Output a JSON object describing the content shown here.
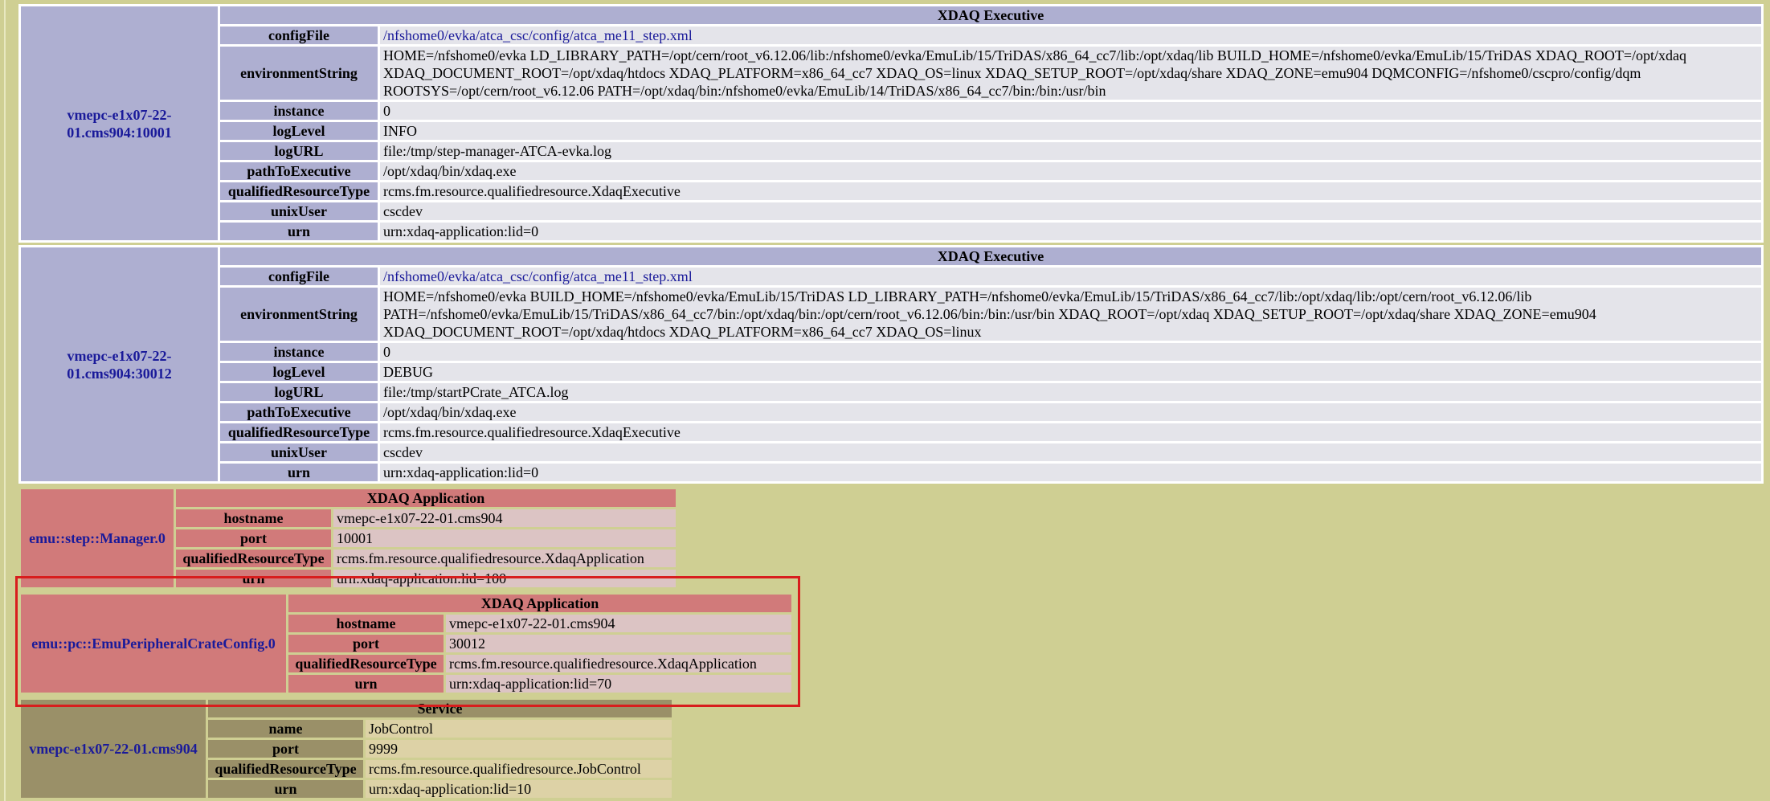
{
  "executives": [
    {
      "host": "vmepc-e1x07-22-01.cms904:10001",
      "header": "XDAQ Executive",
      "rows": [
        {
          "key": "configFile",
          "value": "/nfshome0/evka/atca_csc/config/atca_me11_step.xml"
        },
        {
          "key": "environmentString",
          "value": "HOME=/nfshome0/evka LD_LIBRARY_PATH=/opt/cern/root_v6.12.06/lib:/nfshome0/evka/EmuLib/15/TriDAS/x86_64_cc7/lib:/opt/xdaq/lib BUILD_HOME=/nfshome0/evka/EmuLib/15/TriDAS XDAQ_ROOT=/opt/xdaq XDAQ_DOCUMENT_ROOT=/opt/xdaq/htdocs XDAQ_PLATFORM=x86_64_cc7 XDAQ_OS=linux XDAQ_SETUP_ROOT=/opt/xdaq/share XDAQ_ZONE=emu904 DQMCONFIG=/nfshome0/cscpro/config/dqm ROOTSYS=/opt/cern/root_v6.12.06 PATH=/opt/xdaq/bin:/nfshome0/evka/EmuLib/14/TriDAS/x86_64_cc7/bin:/bin:/usr/bin"
        },
        {
          "key": "instance",
          "value": "0"
        },
        {
          "key": "logLevel",
          "value": "INFO"
        },
        {
          "key": "logURL",
          "value": "file:/tmp/step-manager-ATCA-evka.log"
        },
        {
          "key": "pathToExecutive",
          "value": "/opt/xdaq/bin/xdaq.exe"
        },
        {
          "key": "qualifiedResourceType",
          "value": "rcms.fm.resource.qualifiedresource.XdaqExecutive"
        },
        {
          "key": "unixUser",
          "value": "cscdev"
        },
        {
          "key": "urn",
          "value": "urn:xdaq-application:lid=0"
        }
      ]
    },
    {
      "host": "vmepc-e1x07-22-01.cms904:30012",
      "header": "XDAQ Executive",
      "rows": [
        {
          "key": "configFile",
          "value": "/nfshome0/evka/atca_csc/config/atca_me11_step.xml"
        },
        {
          "key": "environmentString",
          "value": "HOME=/nfshome0/evka BUILD_HOME=/nfshome0/evka/EmuLib/15/TriDAS LD_LIBRARY_PATH=/nfshome0/evka/EmuLib/15/TriDAS/x86_64_cc7/lib:/opt/xdaq/lib:/opt/cern/root_v6.12.06/lib PATH=/nfshome0/evka/EmuLib/15/TriDAS/x86_64_cc7/bin:/opt/xdaq/bin:/opt/cern/root_v6.12.06/bin:/bin:/usr/bin XDAQ_ROOT=/opt/xdaq XDAQ_SETUP_ROOT=/opt/xdaq/share XDAQ_ZONE=emu904 XDAQ_DOCUMENT_ROOT=/opt/xdaq/htdocs XDAQ_PLATFORM=x86_64_cc7 XDAQ_OS=linux"
        },
        {
          "key": "instance",
          "value": "0"
        },
        {
          "key": "logLevel",
          "value": "DEBUG"
        },
        {
          "key": "logURL",
          "value": "file:/tmp/startPCrate_ATCA.log"
        },
        {
          "key": "pathToExecutive",
          "value": "/opt/xdaq/bin/xdaq.exe"
        },
        {
          "key": "qualifiedResourceType",
          "value": "rcms.fm.resource.qualifiedresource.XdaqExecutive"
        },
        {
          "key": "unixUser",
          "value": "cscdev"
        },
        {
          "key": "urn",
          "value": "urn:xdaq-application:lid=0"
        }
      ]
    }
  ],
  "applications": [
    {
      "host": "emu::step::Manager.0",
      "header": "XDAQ Application",
      "rows": [
        {
          "key": "hostname",
          "value": "vmepc-e1x07-22-01.cms904"
        },
        {
          "key": "port",
          "value": "10001"
        },
        {
          "key": "qualifiedResourceType",
          "value": "rcms.fm.resource.qualifiedresource.XdaqApplication"
        },
        {
          "key": "urn",
          "value": "urn:xdaq-application:lid=100"
        }
      ]
    },
    {
      "host": "emu::pc::EmuPeripheralCrateConfig.0",
      "header": "XDAQ Application",
      "rows": [
        {
          "key": "hostname",
          "value": "vmepc-e1x07-22-01.cms904"
        },
        {
          "key": "port",
          "value": "30012"
        },
        {
          "key": "qualifiedResourceType",
          "value": "rcms.fm.resource.qualifiedresource.XdaqApplication"
        },
        {
          "key": "urn",
          "value": "urn:xdaq-application:lid=70"
        }
      ]
    }
  ],
  "service": {
    "host": "vmepc-e1x07-22-01.cms904",
    "header": "Service",
    "rows": [
      {
        "key": "name",
        "value": "JobControl"
      },
      {
        "key": "port",
        "value": "9999"
      },
      {
        "key": "qualifiedResourceType",
        "value": "rcms.fm.resource.qualifiedresource.JobControl"
      },
      {
        "key": "urn",
        "value": "urn:xdaq-application:lid=10"
      }
    ]
  }
}
